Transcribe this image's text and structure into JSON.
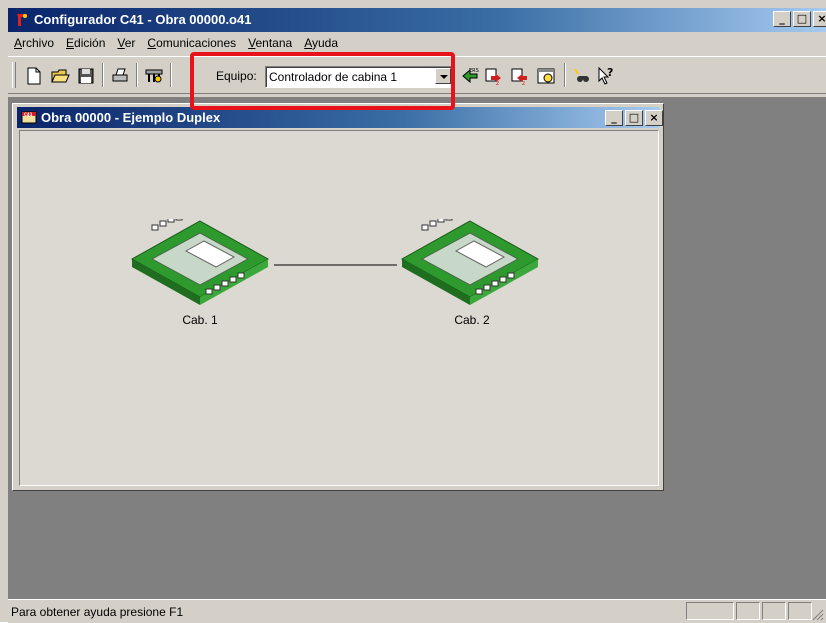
{
  "window": {
    "title": "Configurador C41 - Obra 00000.o41",
    "min": "_",
    "max": "□",
    "close": "×"
  },
  "menu": [
    {
      "accel": "A",
      "rest": "rchivo"
    },
    {
      "accel": "E",
      "rest": "dición"
    },
    {
      "accel": "V",
      "rest": "er"
    },
    {
      "accel": "C",
      "rest": "omunicaciones"
    },
    {
      "accel": "V",
      "rest": "entana"
    },
    {
      "accel": "A",
      "rest": "yuda"
    }
  ],
  "toolbar": {
    "equipo_label": "Equipo:",
    "equipo_value": "Controlador de cabina 1",
    "icons": [
      "new-icon",
      "open-icon",
      "save-icon",
      "print-icon",
      "settings-icon",
      "ers-icon",
      "download-icon",
      "upload-icon",
      "clock-icon",
      "find-icon",
      "help-pointer-icon"
    ]
  },
  "child_window": {
    "title": "Obra 00000 - Ejemplo Duplex",
    "min": "_",
    "max": "□",
    "close": "×"
  },
  "diagram": {
    "nodes": [
      {
        "label": "Cab. 1"
      },
      {
        "label": "Cab. 2"
      }
    ]
  },
  "status": {
    "text": "Para obtener ayuda presione F1"
  },
  "colors": {
    "title_active": "#0a246a",
    "highlight": "#e8121a",
    "board_green": "#2e9a2e"
  }
}
